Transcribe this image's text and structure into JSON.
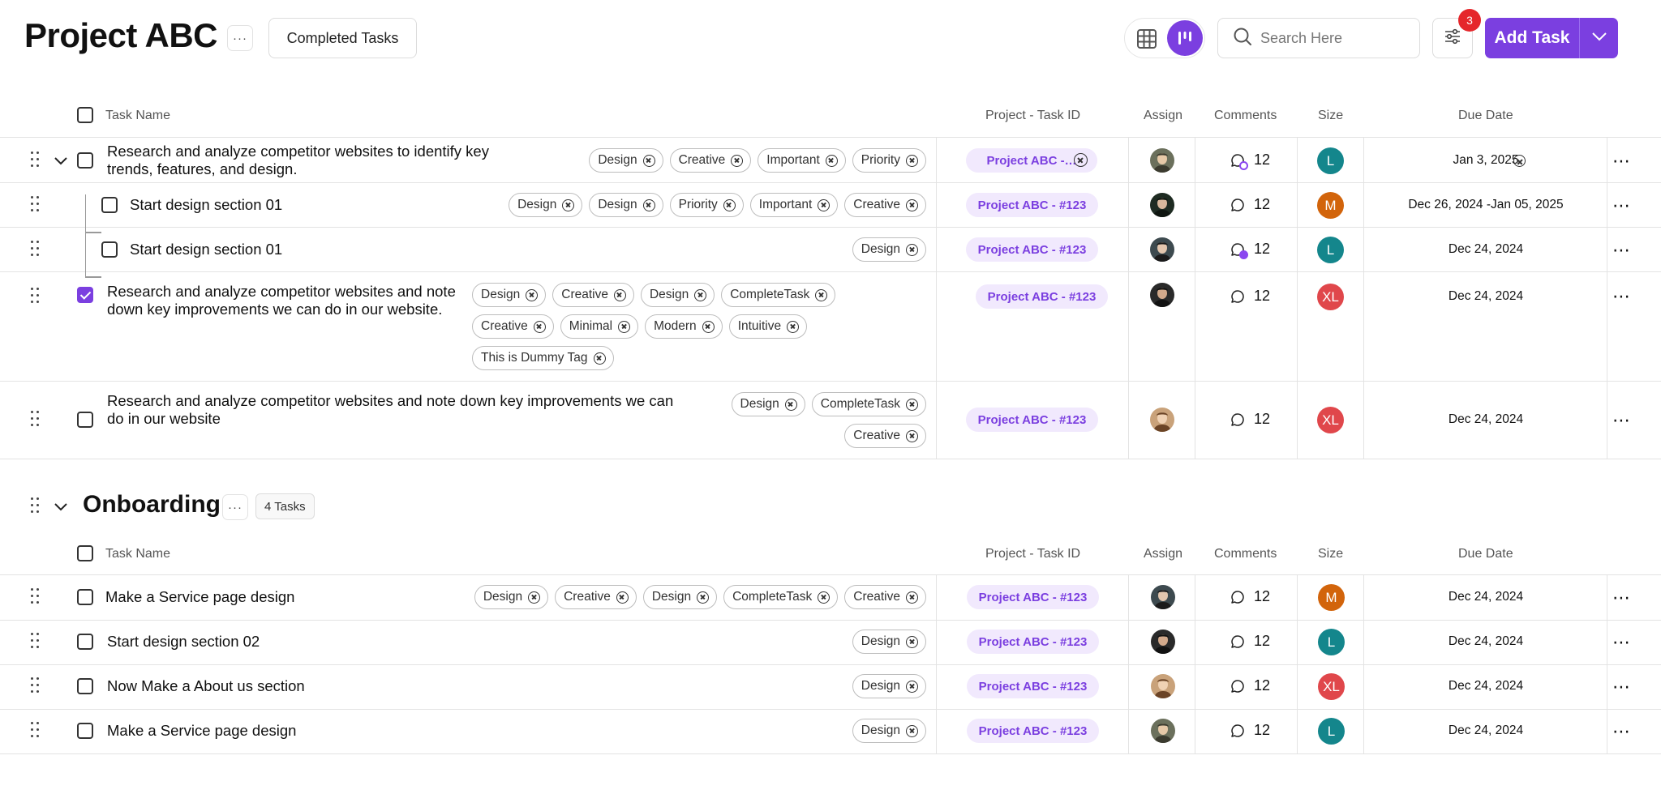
{
  "header": {
    "title": "Project ABC",
    "completed_label": "Completed Tasks",
    "search_placeholder": "Search Here",
    "filter_count": "3",
    "add_label": "Add Task",
    "accent": "#7b3fe0"
  },
  "columns": {
    "task_name": "Task Name",
    "project_id": "Project - Task ID",
    "assign": "Assign",
    "comments": "Comments",
    "size": "Size",
    "due": "Due Date"
  },
  "tasks": [
    {
      "name": "Research and analyze competitor websites to identify key trends, features, and design.",
      "checked": false,
      "tags": [
        "Design",
        "Creative",
        "Important",
        "Priority"
      ],
      "project_id": "Project ABC -…",
      "comments": "12",
      "size": "L",
      "size_color": "#14868c",
      "due": "Jan 3, 2025"
    },
    {
      "name": "Start design section 01",
      "checked": false,
      "tags": [
        "Design",
        "Design",
        "Priority",
        "Important",
        "Creative"
      ],
      "project_id": "Project ABC - #123",
      "comments": "12",
      "size": "M",
      "size_color": "#d2640b",
      "due": "Dec 26, 2024  -Jan 05, 2025"
    },
    {
      "name": "Start design section 01",
      "checked": false,
      "tags": [
        "Design"
      ],
      "project_id": "Project ABC - #123",
      "comments": "12",
      "size": "L",
      "size_color": "#14868c",
      "due": "Dec 24, 2024"
    },
    {
      "name": "Research and analyze competitor websites and note down key improvements we can do in our website.",
      "checked": true,
      "tags": [
        "Design",
        "Creative",
        "Design",
        "CompleteTask",
        "Creative",
        "Minimal",
        "Modern",
        "Intuitive",
        "This is Dummy Tag"
      ],
      "project_id": "Project ABC - #123",
      "comments": "12",
      "size": "XL",
      "size_color": "#e0474b",
      "due": "Dec 24, 2024"
    },
    {
      "name": "Research and analyze competitor websites and note down key improvements we can do in our website",
      "checked": false,
      "tags": [
        "Design",
        "CompleteTask",
        "Creative"
      ],
      "project_id": "Project ABC - #123",
      "comments": "12",
      "size": "XL",
      "size_color": "#e0474b",
      "due": "Dec 24, 2024"
    }
  ],
  "onboarding": {
    "title": "Onboarding",
    "count": "4 Tasks",
    "tasks": [
      {
        "name": "Make a Service page design",
        "tags": [
          "Design",
          "Creative",
          "Design",
          "CompleteTask",
          "Creative"
        ],
        "project_id": "Project ABC - #123",
        "comments": "12",
        "size": "M",
        "size_color": "#d2640b",
        "due": "Dec 24, 2024"
      },
      {
        "name": "Start design section 02",
        "tags": [
          "Design"
        ],
        "project_id": "Project ABC - #123",
        "comments": "12",
        "size": "L",
        "size_color": "#14868c",
        "due": "Dec 24, 2024"
      },
      {
        "name": "Now Make a About us section",
        "tags": [
          "Design"
        ],
        "project_id": "Project ABC - #123",
        "comments": "12",
        "size": "XL",
        "size_color": "#e0474b",
        "due": "Dec 24, 2024"
      },
      {
        "name": "Make a Service page design",
        "tags": [
          "Design"
        ],
        "project_id": "Project ABC - #123",
        "comments": "12",
        "size": "L",
        "size_color": "#14868c",
        "due": "Dec 24, 2024"
      }
    ]
  }
}
